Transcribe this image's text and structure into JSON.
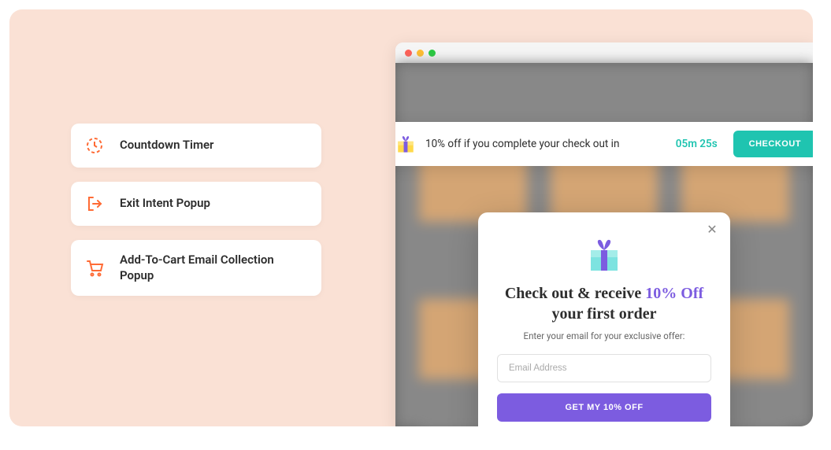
{
  "features": [
    {
      "label": "Countdown Timer",
      "icon": "timer"
    },
    {
      "label": "Exit Intent Popup",
      "icon": "exit"
    },
    {
      "label": "Add-To-Cart Email Collection Popup",
      "icon": "cart"
    }
  ],
  "countdown_bar": {
    "message": "10% off if you complete your check out in",
    "time": "05m 25s",
    "button_label": "CHECKOUT"
  },
  "popup": {
    "title_pre": "Check out & receive ",
    "title_highlight": "10% Off",
    "title_post": " your first order",
    "subtitle": "Enter your email for your exclusive offer:",
    "placeholder": "Email Address",
    "button_label": "GET MY 10% OFF"
  }
}
